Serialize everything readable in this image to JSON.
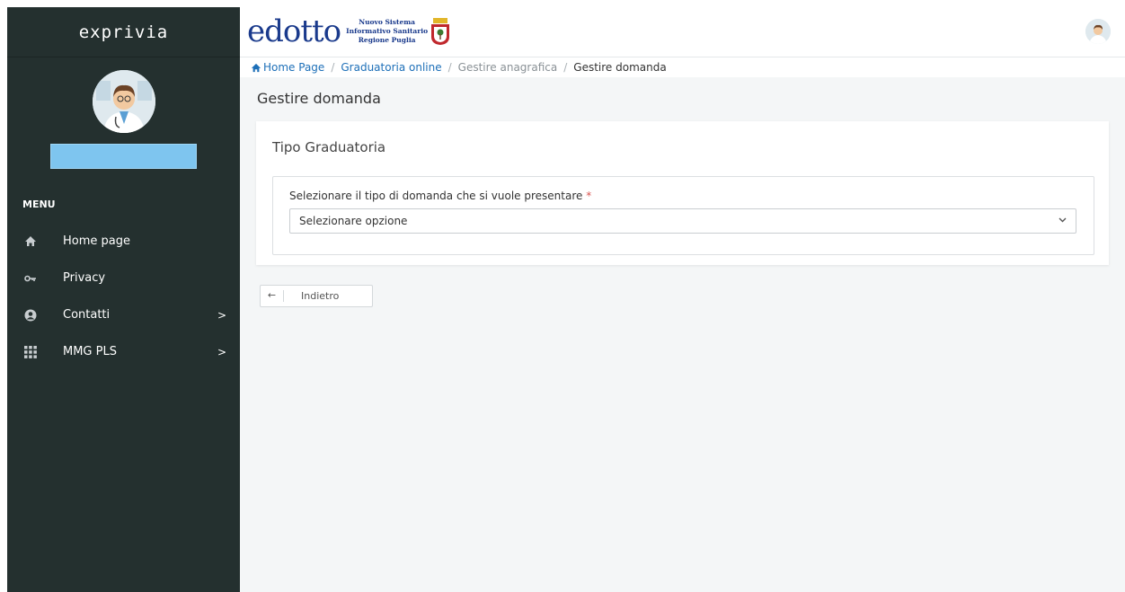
{
  "sidebar": {
    "brand": "exprivia",
    "username": "",
    "menu_title": "MENU",
    "items": [
      {
        "label": "Home page",
        "icon": "home-icon",
        "chevron": ""
      },
      {
        "label": "Privacy",
        "icon": "key-icon",
        "chevron": ""
      },
      {
        "label": "Contatti",
        "icon": "user-circle-icon",
        "chevron": ">"
      },
      {
        "label": "MMG PLS",
        "icon": "grid-icon",
        "chevron": ">"
      }
    ]
  },
  "header": {
    "logo_word": "edotto",
    "logo_line1": "Nuovo Sistema",
    "logo_line2": "Informativo Sanitario",
    "logo_line3": "Regione Puglia"
  },
  "breadcrumb": {
    "home": "Home Page",
    "item2": "Graduatoria online",
    "item3": "Gestire anagrafica",
    "item4": "Gestire domanda",
    "separator": "/"
  },
  "page": {
    "title": "Gestire domanda",
    "card_title": "Tipo Graduatoria",
    "field_label": "Selezionare il tipo di domanda che si vuole presentare",
    "required_mark": "*",
    "select_value": "Selezionare opzione",
    "back_arrow": "←",
    "back_label": "Indietro"
  },
  "colors": {
    "sidebar_bg": "#24302f",
    "link": "#1d6fb8",
    "required": "#d9534f",
    "content_bg": "#f4f6f7"
  }
}
